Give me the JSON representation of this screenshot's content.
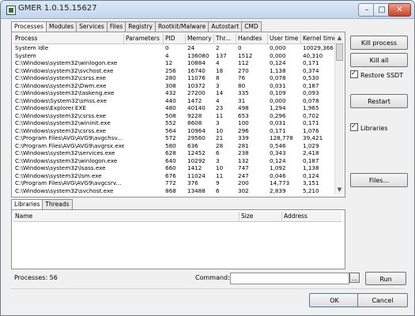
{
  "window": {
    "title": "GMER 1.0.15.15627"
  },
  "tabs": [
    "Processes",
    "Modules",
    "Services",
    "Files",
    "Registry",
    "Rootkit/Malware",
    "Autostart",
    "CMD"
  ],
  "process_table": {
    "columns": [
      "Process",
      "Parameters",
      "PID",
      "Memory",
      "Thr...",
      "Handles",
      "User time",
      "Kernel time"
    ],
    "rows": [
      [
        "System Idle",
        "",
        "0",
        "24",
        "2",
        "0",
        "0,000",
        "10029,366"
      ],
      [
        "System",
        "",
        "4",
        "136080",
        "137",
        "1512",
        "0,000",
        "40,310"
      ],
      [
        "C:\\Windows\\system32\\winlogon.exe",
        "",
        "12",
        "10884",
        "4",
        "112",
        "0,124",
        "0,171"
      ],
      [
        "C:\\Windows\\system32\\svchost.exe",
        "",
        "256",
        "16740",
        "18",
        "270",
        "1,138",
        "0,374"
      ],
      [
        "C:\\Windows\\system32\\csrss.exe",
        "",
        "280",
        "11076",
        "8",
        "76",
        "0,078",
        "0,530"
      ],
      [
        "C:\\Windows\\system32\\Dwm.exe",
        "",
        "308",
        "10372",
        "3",
        "80",
        "0,031",
        "0,187"
      ],
      [
        "C:\\Windows\\system32\\taskeng.exe",
        "",
        "432",
        "27200",
        "14",
        "335",
        "0,109",
        "0,093"
      ],
      [
        "C:\\Windows\\System32\\smss.exe",
        "",
        "440",
        "1472",
        "4",
        "31",
        "0,000",
        "0,078"
      ],
      [
        "C:\\Windows\\Explorer.EXE",
        "",
        "480",
        "40140",
        "23",
        "498",
        "1,294",
        "1,965"
      ],
      [
        "C:\\Windows\\system32\\csrss.exe",
        "",
        "508",
        "9228",
        "11",
        "653",
        "0,296",
        "0,702"
      ],
      [
        "C:\\Windows\\system32\\wininit.exe",
        "",
        "552",
        "8608",
        "3",
        "100",
        "0,031",
        "0,171"
      ],
      [
        "C:\\Windows\\system32\\csrss.exe",
        "",
        "564",
        "10964",
        "10",
        "296",
        "0,171",
        "1,076"
      ],
      [
        "C:\\Program Files\\AVG\\AVG9\\avgchsv...",
        "",
        "572",
        "29560",
        "21",
        "339",
        "128,778",
        "39,421"
      ],
      [
        "C:\\Program Files\\AVG\\AVG9\\avgrsx.exe",
        "",
        "580",
        "636",
        "28",
        "281",
        "0,546",
        "1,029"
      ],
      [
        "C:\\Windows\\system32\\services.exe",
        "",
        "628",
        "12452",
        "6",
        "238",
        "0,343",
        "2,418"
      ],
      [
        "C:\\Windows\\system32\\winlogon.exe",
        "",
        "640",
        "10292",
        "3",
        "132",
        "0,124",
        "0,187"
      ],
      [
        "C:\\Windows\\system32\\lsass.exe",
        "",
        "660",
        "1412",
        "10",
        "747",
        "1,092",
        "1,138"
      ],
      [
        "C:\\Windows\\system32\\lsm.exe",
        "",
        "676",
        "11024",
        "11",
        "247",
        "0,046",
        "0,124"
      ],
      [
        "C:\\Program Files\\AVG\\AVG9\\avgcsrv...",
        "",
        "772",
        "376",
        "9",
        "200",
        "14,773",
        "3,151"
      ],
      [
        "C:\\Windows\\system32\\svchost.exe",
        "",
        "868",
        "13488",
        "6",
        "302",
        "2,839",
        "5,210"
      ]
    ]
  },
  "side_buttons": {
    "kill_process": "Kill process",
    "kill_all": "Kill all",
    "restore_ssdt": "Restore SSDT",
    "restart": "Restart",
    "libraries": "Libraries",
    "files": "Files..."
  },
  "lower_tabs": [
    "Libraries",
    "Threads"
  ],
  "libraries_table": {
    "columns": [
      "Name",
      "Size",
      "Address"
    ]
  },
  "status": {
    "processes": "Processes: 56"
  },
  "command": {
    "label": "Command:",
    "value": "",
    "browse_label": "...",
    "run_label": "Run"
  },
  "dialog": {
    "ok": "OK",
    "cancel": "Cancel"
  }
}
